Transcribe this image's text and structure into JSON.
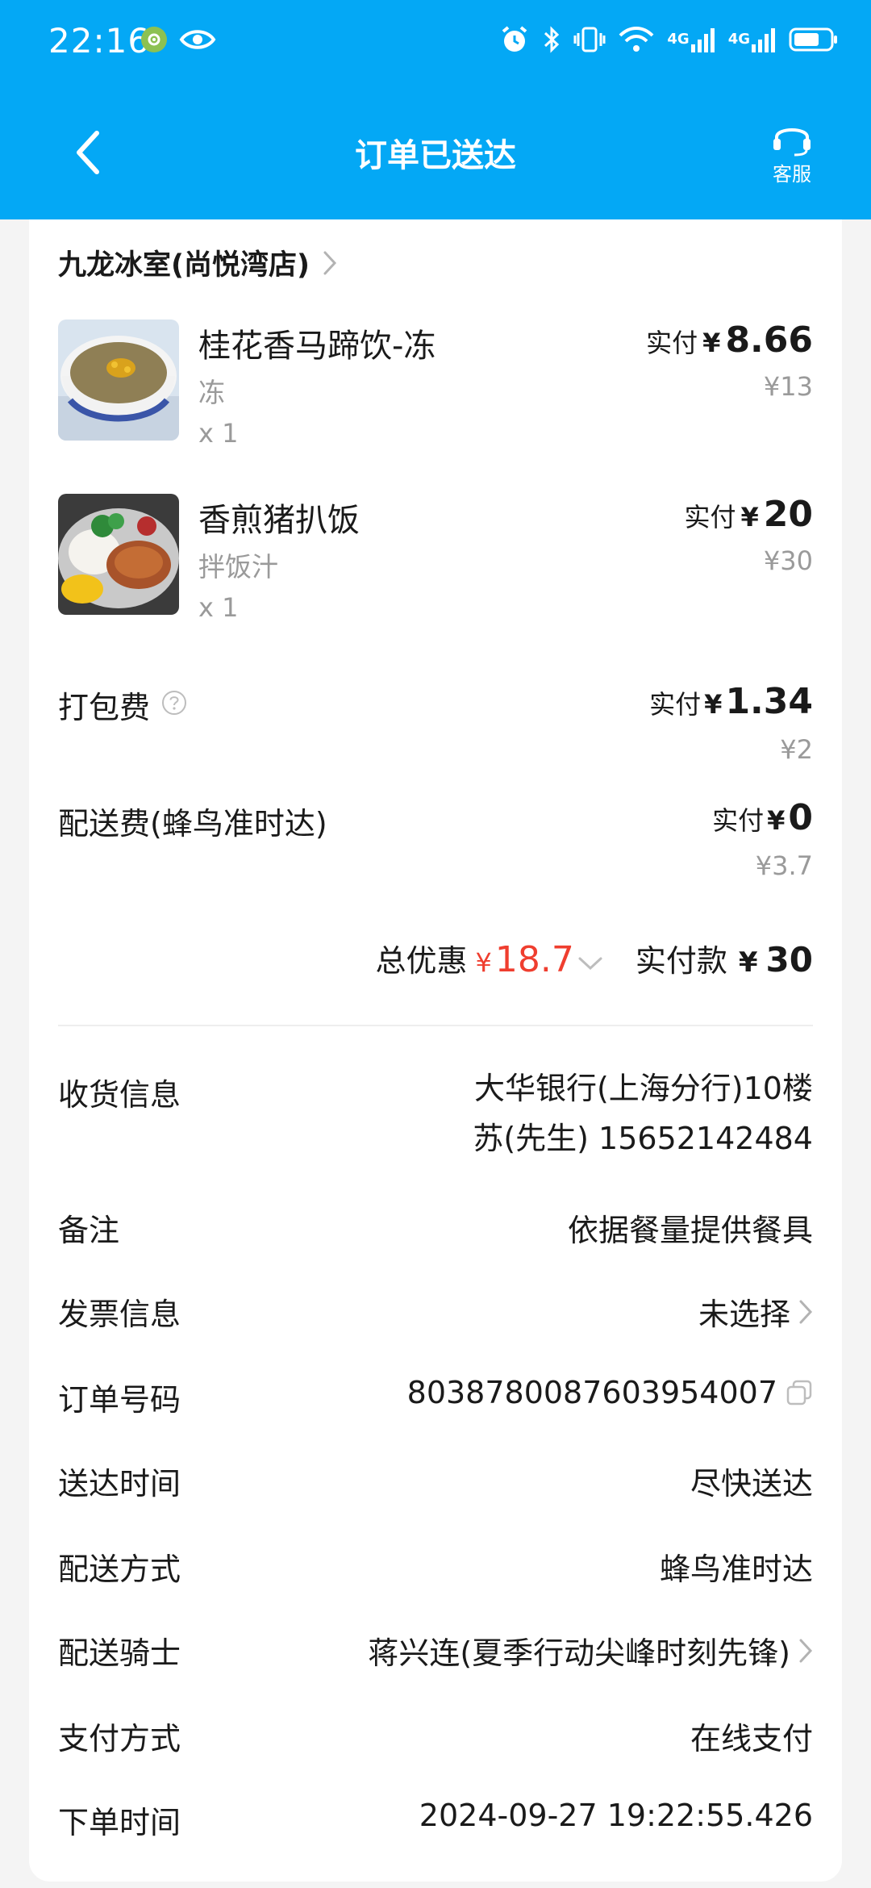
{
  "status_bar": {
    "time": "22:16",
    "network_1": "4G",
    "network_2": "4G"
  },
  "nav": {
    "title": "订单已送达",
    "service_label": "客服"
  },
  "store": {
    "name": "九龙冰室(尚悦湾店)"
  },
  "items": [
    {
      "name": "桂花香马蹄饮-冻",
      "spec": "冻",
      "qty": "x 1",
      "paid_label": "实付",
      "currency": "¥",
      "paid": "8.66",
      "original": "¥13"
    },
    {
      "name": "香煎猪扒饭",
      "spec": "拌饭汁",
      "qty": "x 1",
      "paid_label": "实付",
      "currency": "¥",
      "paid": "20",
      "original": "¥30"
    }
  ],
  "fees": [
    {
      "label": "打包费",
      "paid_label": "实付",
      "currency": "¥",
      "paid": "1.34",
      "original": "¥2"
    },
    {
      "label": "配送费(蜂鸟准时达)",
      "paid_label": "实付",
      "currency": "¥",
      "paid": "0",
      "original": "¥3.7"
    }
  ],
  "totals": {
    "discount_label": "总优惠",
    "currency": "¥",
    "discount": "18.7",
    "paid_label": "实付款",
    "paid": "30"
  },
  "info": {
    "address_label": "收货信息",
    "address_line1": "大华银行(上海分行)10楼",
    "address_line2": "苏(先生) 15652142484",
    "note_label": "备注",
    "note_value": "依据餐量提供餐具",
    "invoice_label": "发票信息",
    "invoice_value": "未选择",
    "order_no_label": "订单号码",
    "order_no_value": "8038780087603954007",
    "delivery_time_label": "送达时间",
    "delivery_time_value": "尽快送达",
    "delivery_method_label": "配送方式",
    "delivery_method_value": "蜂鸟准时达",
    "rider_label": "配送骑士",
    "rider_value": "蒋兴连(夏季行动尖峰时刻先锋)",
    "payment_label": "支付方式",
    "payment_value": "在线支付",
    "order_time_label": "下单时间",
    "order_time_value": "2024-09-27 19:22:55.426"
  },
  "colors": {
    "header_bg": "#04a8f5",
    "discount_red": "#ef3e2f",
    "muted_text": "#9a9a9a"
  }
}
